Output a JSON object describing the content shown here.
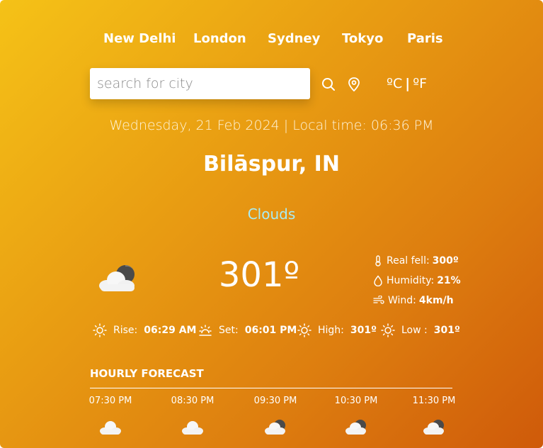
{
  "cities": [
    "New Delhi",
    "London",
    "Sydney",
    "Tokyo",
    "Paris"
  ],
  "search": {
    "placeholder": "search for city"
  },
  "units": {
    "celsius": "ºC",
    "separator": "|",
    "fahrenheit": "ºF"
  },
  "datetime": "Wednesday, 21 Feb 2024 | Local time: 06:36 PM",
  "location": "Bilāspur, IN",
  "condition": "Clouds",
  "temperature": "301º",
  "details": {
    "real_feel_label": "Real fell:",
    "real_feel_value": "300º",
    "humidity_label": "Humidity:",
    "humidity_value": "21%",
    "wind_label": "Wind:",
    "wind_value": "4km/h"
  },
  "sun": {
    "rise_label": "Rise:",
    "rise_value": "06:29 AM",
    "set_label": "Set:",
    "set_value": "06:01 PM",
    "high_label": "High:",
    "high_value": "301º",
    "low_label": "Low :",
    "low_value": "301º"
  },
  "hourly": {
    "title": "HOURLY FORECAST",
    "items": [
      {
        "time": "07:30 PM",
        "icon": "cloud-icon"
      },
      {
        "time": "08:30 PM",
        "icon": "cloud-icon"
      },
      {
        "time": "09:30 PM",
        "icon": "cloud-night-icon"
      },
      {
        "time": "10:30 PM",
        "icon": "cloud-night-icon"
      },
      {
        "time": "11:30 PM",
        "icon": "cloud-night-icon"
      }
    ]
  },
  "colors": {
    "gradient_start": "#f5c217",
    "gradient_end": "#cf5a0a",
    "condition_text": "#a8ecf4"
  }
}
